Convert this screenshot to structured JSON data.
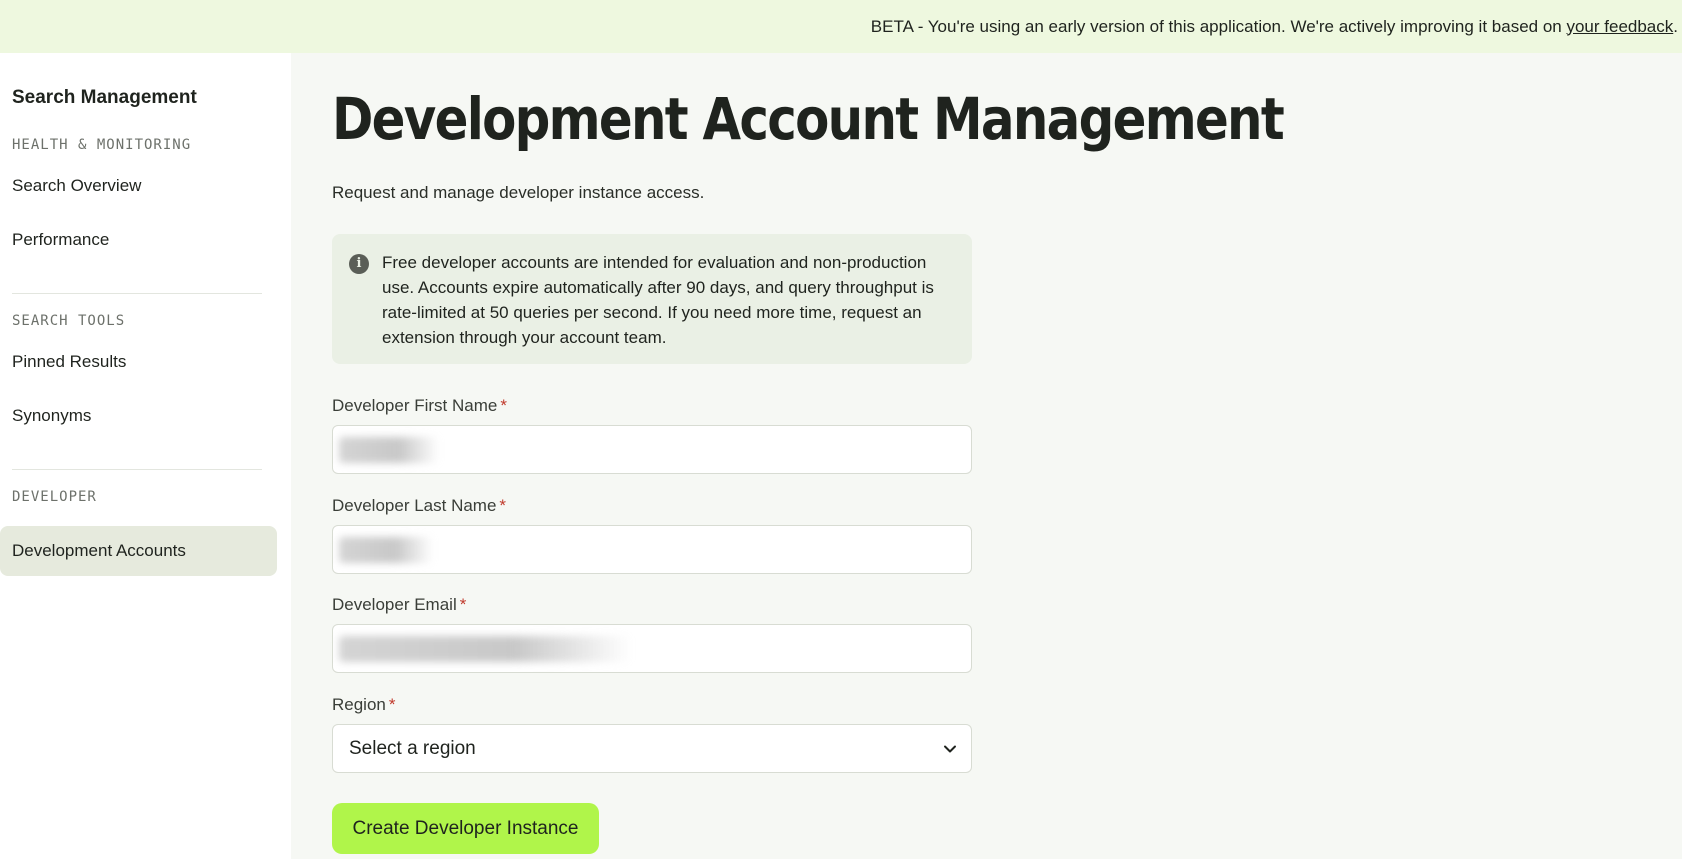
{
  "banner": {
    "text": "BETA - You're using an early version of this application. We're actively improving it based on ",
    "link": "your feedback",
    "suffix": "."
  },
  "sidebar": {
    "title": "Search Management",
    "sections": [
      {
        "label": "HEALTH & MONITORING",
        "items": [
          {
            "label": "Search Overview"
          },
          {
            "label": "Performance"
          }
        ]
      },
      {
        "label": "SEARCH TOOLS",
        "items": [
          {
            "label": "Pinned Results"
          },
          {
            "label": "Synonyms"
          }
        ]
      },
      {
        "label": "DEVELOPER",
        "items": [
          {
            "label": "Development Accounts",
            "active": true
          }
        ]
      }
    ]
  },
  "main": {
    "title": "Development Account Management",
    "subtitle": "Request and manage developer instance access.",
    "info": {
      "icon": "info-icon",
      "text": "Free developer accounts are intended for evaluation and non-production use. Accounts expire automatically after 90 days, and query throughput is rate-limited at 50 queries per second. If you need more time, request an extension through your account team."
    },
    "form": {
      "first_name": {
        "label": "Developer First Name",
        "required": "*"
      },
      "last_name": {
        "label": "Developer Last Name",
        "required": "*"
      },
      "email": {
        "label": "Developer Email",
        "required": "*"
      },
      "region": {
        "label": "Region",
        "required": "*",
        "selected": "Select a region",
        "icon": "chevron-down-icon"
      },
      "submit_label": "Create Developer Instance"
    }
  },
  "colors": {
    "banner_bg": "#eef8df",
    "accent": "#b0f54a",
    "active_nav": "#e6eadd",
    "required": "#c0392b"
  }
}
